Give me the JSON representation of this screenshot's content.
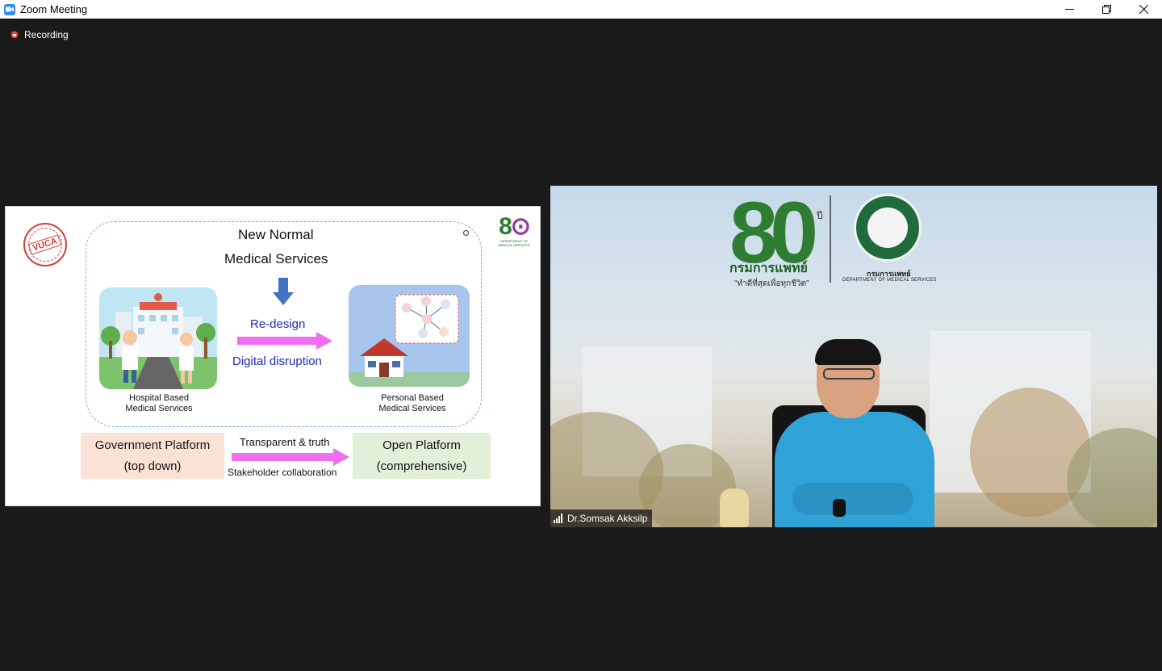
{
  "window": {
    "title": "Zoom Meeting"
  },
  "recording": {
    "label": "Recording"
  },
  "slide": {
    "stamp_text": "VUCA",
    "logo_number": "8",
    "logo_caption": "DEPARTMENT OF MEDICAL SERVICES",
    "title_line1": "New Normal",
    "title_line2": "Medical Services",
    "hospital_caption_line1": "Hospital Based",
    "hospital_caption_line2": "Medical Services",
    "home_caption_line1": "Personal Based",
    "home_caption_line2": "Medical Services",
    "redesign": "Re-design",
    "digital": "Digital disruption",
    "gov_platform_line1": "Government Platform",
    "gov_platform_line2": "(top down)",
    "open_platform_line1": "Open Platform",
    "open_platform_line2": "(comprehensive)",
    "transparent": "Transparent & truth",
    "stakeholder": "Stakeholder collaboration"
  },
  "video": {
    "participant_name": "Dr.Somsak Akksilp",
    "logo_number": "80",
    "logo_suffix": "ปี",
    "logo_thai": "กรมการแพทย์",
    "logo_slogan": "\"ทำดีที่สุดเพื่อทุกชีวิต\"",
    "seal_thai": "กรมการแพทย์",
    "seal_english": "DEPARTMENT OF MEDICAL SERVICES"
  },
  "colors": {
    "accent_blue": "#2d8cff",
    "slide_text_blue": "#1f2db8",
    "arrow_pink": "#f06ef0",
    "gov_box": "#fbe2d6",
    "open_box": "#e2efd9"
  }
}
